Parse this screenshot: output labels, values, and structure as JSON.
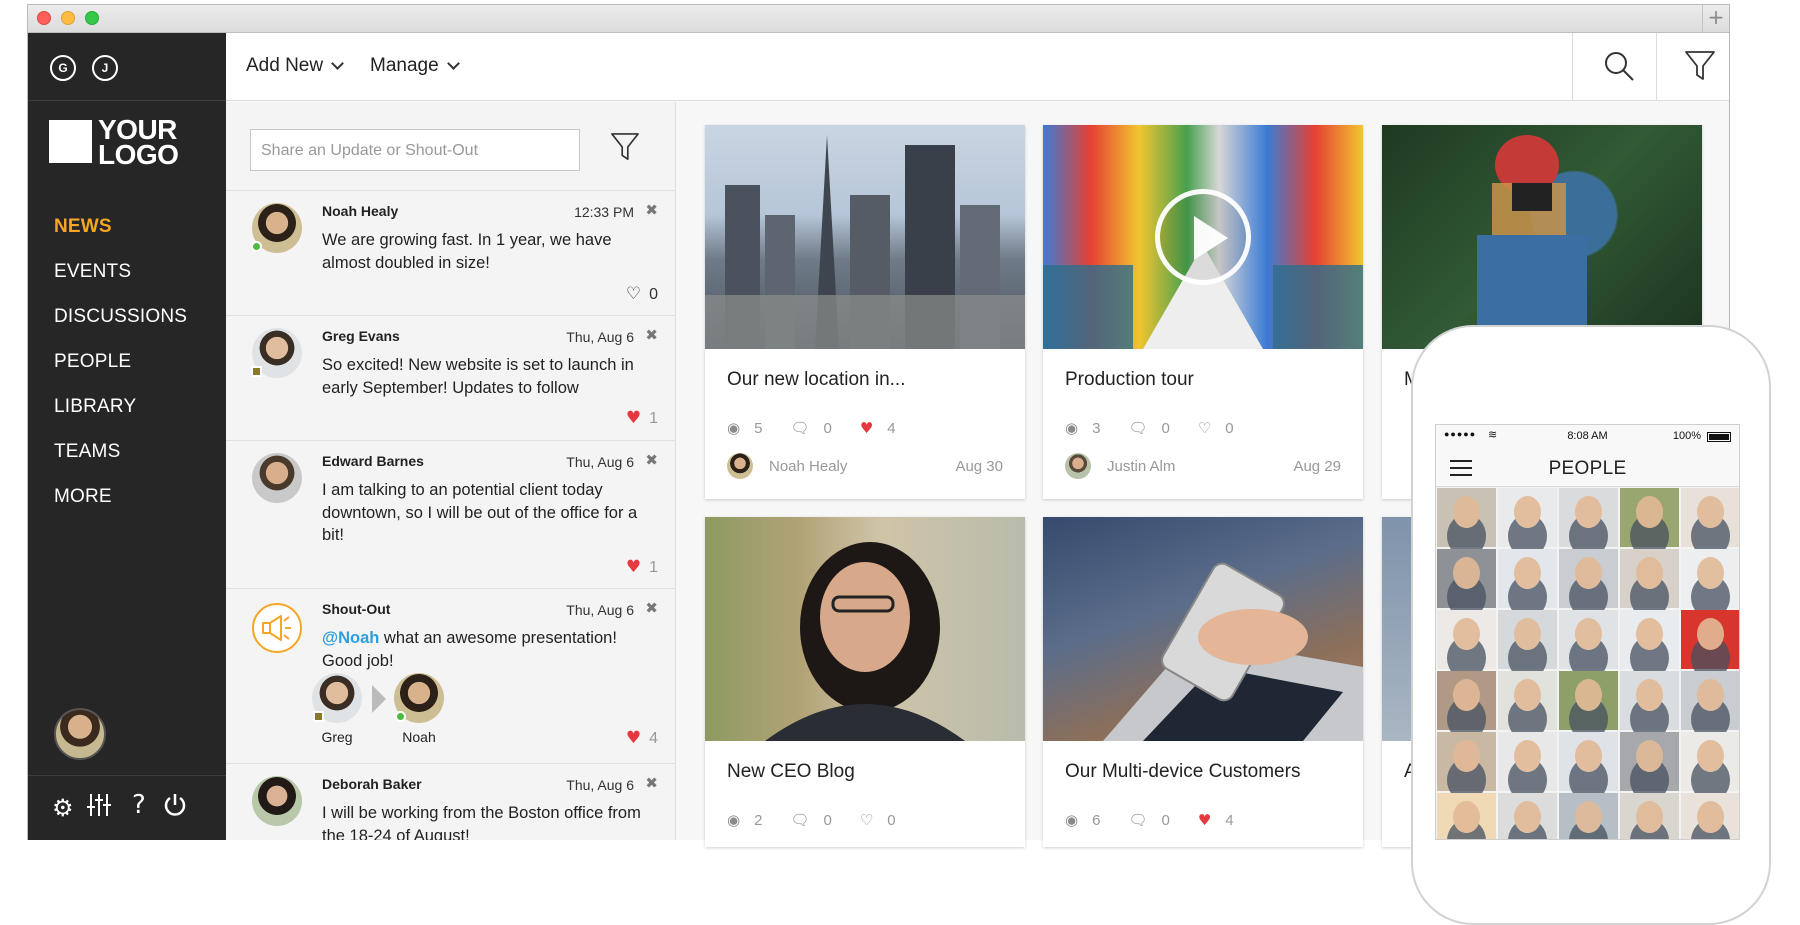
{
  "sidebar": {
    "buttons": [
      "G",
      "J"
    ],
    "logo": "YOUR LOGO",
    "nav": [
      "NEWS",
      "EVENTS",
      "DISCUSSIONS",
      "PEOPLE",
      "LIBRARY",
      "TEAMS",
      "MORE"
    ],
    "active": "NEWS",
    "bottom_icons": [
      "gear-icon",
      "sliders-icon",
      "help-icon",
      "power-icon"
    ]
  },
  "topbar": {
    "menus": [
      "Add New",
      "Manage"
    ],
    "icons": [
      "search-icon",
      "filter-icon"
    ]
  },
  "feed": {
    "share_placeholder": "Share an Update or Shout-Out",
    "posts": [
      {
        "name": "Noah Healy",
        "time": "12:33 PM",
        "text": "We are growing fast. In 1 year, we have almost doubled in size!",
        "likes": "0",
        "liked": false,
        "status": "online"
      },
      {
        "name": "Greg Evans",
        "time": "Thu, Aug 6",
        "text": "So excited! New website is set to launch in early September! Updates to follow",
        "likes": "1",
        "liked": true,
        "status": "away"
      },
      {
        "name": "Edward Barnes",
        "time": "Thu, Aug 6",
        "text": "I am talking to an potential client today downtown, so I will be out of the office for a bit!",
        "likes": "1",
        "liked": true,
        "status": "none"
      },
      {
        "name": "Shout-Out",
        "time": "Thu, Aug 6",
        "mention": "@Noah",
        "text": " what an awesome presentation! Good job!",
        "from": "Greg",
        "to": "Noah",
        "likes": "4",
        "liked": true
      },
      {
        "name": "Deborah Baker",
        "time": "Thu, Aug 6",
        "text": "I will be working from the Boston office from the 18-24 of August!"
      }
    ]
  },
  "cards": [
    {
      "title": "Our new location in...",
      "views": "5",
      "comments": "0",
      "likes": "4",
      "liked": true,
      "author": "Noah Healy",
      "date": "Aug 30"
    },
    {
      "title": "Production tour",
      "views": "3",
      "comments": "0",
      "likes": "0",
      "liked": false,
      "author": "Justin Alm",
      "date": "Aug 29"
    },
    {
      "title": "M",
      "views": "",
      "comments": "",
      "likes": "",
      "liked": false,
      "author": "",
      "date": ""
    },
    {
      "title": "New CEO Blog",
      "views": "2",
      "comments": "0",
      "likes": "0",
      "liked": false
    },
    {
      "title": "Our Multi-device Customers",
      "views": "6",
      "comments": "0",
      "likes": "4",
      "liked": true
    },
    {
      "title": "A"
    }
  ],
  "phone": {
    "signal": "●●●●●",
    "time": "8:08 AM",
    "battery": "100%",
    "title": "PEOPLE"
  }
}
